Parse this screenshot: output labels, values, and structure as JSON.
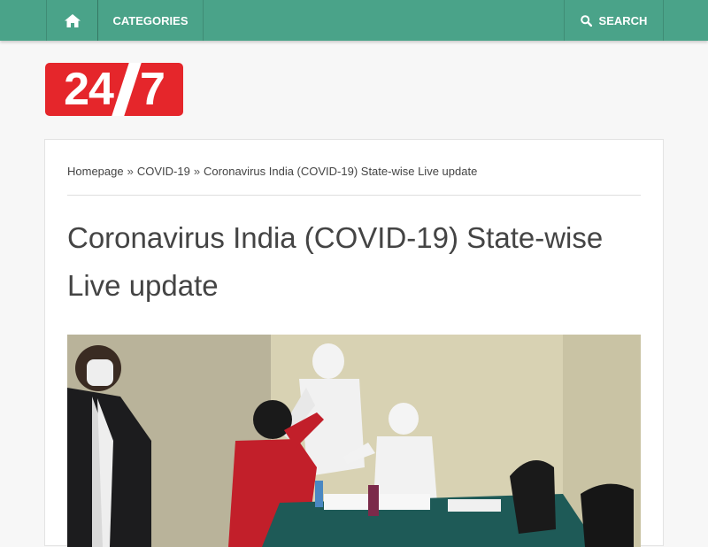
{
  "nav": {
    "home_icon": "home-icon",
    "categories_label": "CATEGORIES",
    "search_icon": "search-icon",
    "search_label": "SEARCH"
  },
  "logo": {
    "left": "24",
    "right": "7"
  },
  "breadcrumb": {
    "items": [
      "Homepage",
      "COVID-19",
      "Coronavirus India (COVID-19) State-wise Live update"
    ],
    "separator": "»"
  },
  "article": {
    "title": "Coronavirus India (COVID-19) State-wise Live update"
  },
  "colors": {
    "nav_bg": "#4aa389",
    "logo_red": "#e5262b"
  }
}
